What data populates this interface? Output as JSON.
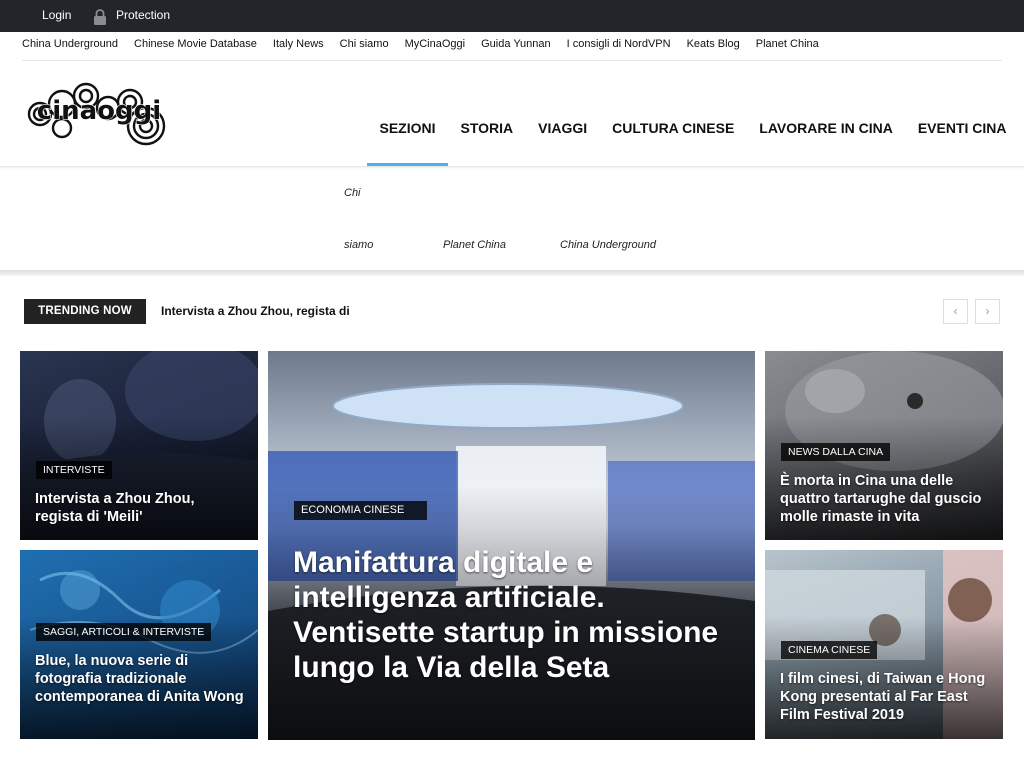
{
  "topbar": {
    "login": "Login",
    "protection": "Protection"
  },
  "links": [
    "China Underground",
    "Chinese Movie Database",
    "Italy News",
    "Chi siamo",
    "MyCinaOggi",
    "Guida Yunnan",
    "I consigli di NordVPN",
    "Keats Blog",
    "Planet China"
  ],
  "logo_text": "cinaoggi",
  "nav": [
    "SEZIONI",
    "STORIA",
    "VIAGGI",
    "CULTURA CINESE",
    "LAVORARE IN CINA",
    "EVENTI CINA"
  ],
  "submenu": {
    "chi": "Chi",
    "siamo": "siamo",
    "planet": "Planet China",
    "underground": "China Underground"
  },
  "trending": {
    "label": "TRENDING NOW",
    "text": "Intervista a Zhou Zhou, regista di",
    "prev": "‹",
    "next": "›"
  },
  "tiles": [
    {
      "category": "INTERVISTE",
      "title": "Intervista a Zhou Zhou, regista di 'Meili'"
    },
    {
      "category": "SAGGI, ARTICOLI & INTERVISTE",
      "title": "Blue, la nuova serie di fotografia tradizionale contemporanea di Anita Wong"
    },
    {
      "category": "ECONOMIA CINESE",
      "title": "Manifattura digitale e intelligenza artificiale. Ventisette startup in missione lungo la Via della Seta"
    },
    {
      "category": "NEWS DALLA CINA",
      "title": "È morta in Cina una delle quattro tartarughe dal guscio molle rimaste in vita"
    },
    {
      "category": "CINEMA CINESE",
      "title": "I film cinesi, di Taiwan e Hong Kong presentati al Far East Film Festival 2019"
    }
  ],
  "colors": {
    "topbar": "#23252b",
    "accent": "#4db2ec",
    "badge": "#222222"
  }
}
